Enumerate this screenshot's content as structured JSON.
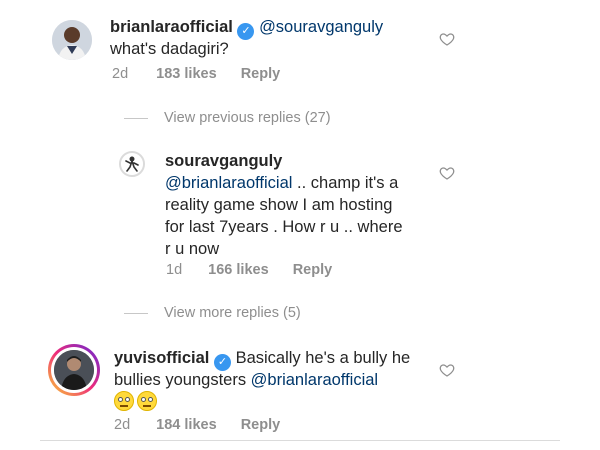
{
  "comments": [
    {
      "username": "brianlaraofficial",
      "mention": "@souravganguly",
      "text_lines": [
        "what's dadagiri?"
      ],
      "time": "2d",
      "likes": "183 likes",
      "reply": "Reply",
      "verified": true
    },
    {
      "username": "souravganguly",
      "mention": "@brianlaraofficial",
      "text_first": " .. champ it's a",
      "text_lines": [
        "reality game show I am hosting",
        "for last 7years . How r u .. where",
        "r u now"
      ],
      "time": "1d",
      "likes": "166 likes",
      "reply": "Reply"
    },
    {
      "username": "yuvisofficial",
      "text_first": "Basically he's a bully he",
      "text_line2": "bullies youngsters ",
      "mention": "@brianlaraofficial",
      "time": "2d",
      "likes": "184 likes",
      "reply": "Reply",
      "verified": true
    }
  ],
  "view_previous_replies": "View previous replies (27)",
  "view_more_replies": "View more replies (5)",
  "verified_glyph": "✓",
  "icons": {
    "heart": "heart-outline-icon",
    "verified": "verified-badge-icon",
    "emoji": "grimacing-face-emoji"
  },
  "colors": {
    "mention": "#00376b",
    "muted": "#8e8e8e",
    "verified": "#3897f0"
  }
}
